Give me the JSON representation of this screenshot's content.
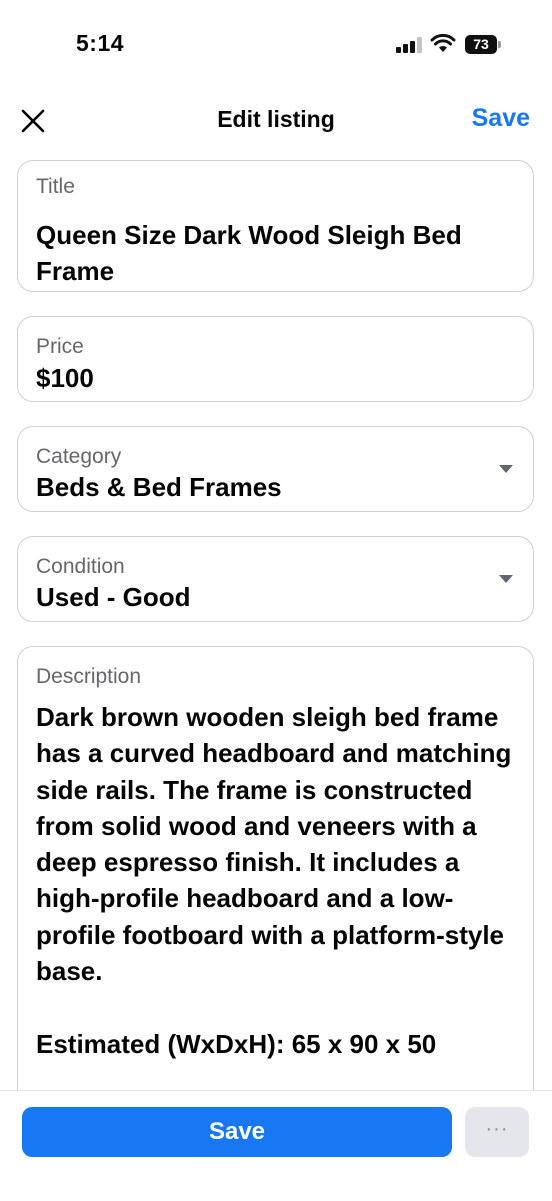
{
  "status_bar": {
    "time": "5:14",
    "battery": "73"
  },
  "nav": {
    "title": "Edit listing",
    "save_label": "Save"
  },
  "fields": {
    "title": {
      "label": "Title",
      "value": "Queen Size Dark Wood Sleigh Bed Frame"
    },
    "price": {
      "label": "Price",
      "value": "$100"
    },
    "category": {
      "label": "Category",
      "value": "Beds & Bed Frames"
    },
    "condition": {
      "label": "Condition",
      "value": "Used - Good"
    },
    "description": {
      "label": "Description",
      "value": "Dark brown wooden sleigh bed frame has a curved headboard and matching side rails. The frame is constructed from solid wood and veneers with a deep espresso finish. It includes a high-profile headboard and a low-profile footboard with a platform-style base.\n\nEstimated (WxDxH): 65 x 90 x 50"
    }
  },
  "bottom_bar": {
    "save_label": "Save",
    "more_label": "···"
  },
  "colors": {
    "accent": "#1877f2",
    "border": "#ced0d4",
    "label": "#65676b",
    "more_bg": "#e4e6eb"
  }
}
